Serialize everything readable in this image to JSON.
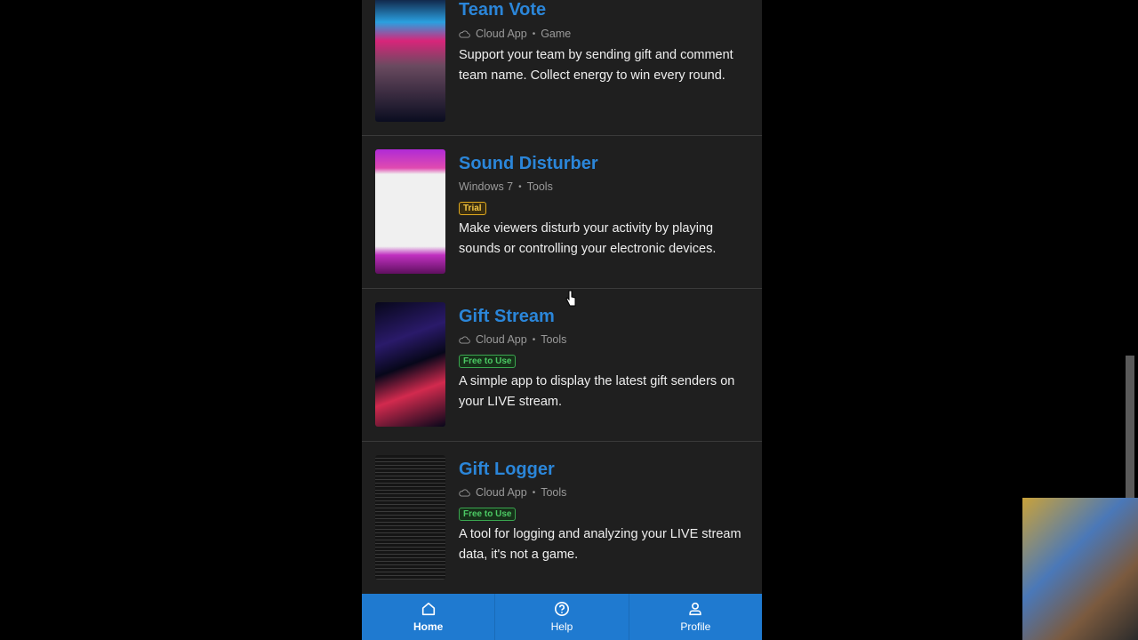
{
  "apps": [
    {
      "title": "Team Vote",
      "platform": "Cloud App",
      "category": "Game",
      "badge": null,
      "description": "Support your team by sending gift and comment team name. Collect energy to win every round.",
      "thumb_colors": [
        "#0e1a3a",
        "#d8257a"
      ]
    },
    {
      "title": "Sound Disturber",
      "platform": "Windows 7",
      "category": "Tools",
      "badge": "Trial",
      "description": "Make viewers disturb your activity by playing sounds or controlling your electronic devices.",
      "thumb_colors": [
        "#b02ad6",
        "#f0f0f0"
      ]
    },
    {
      "title": "Gift Stream",
      "platform": "Cloud App",
      "category": "Tools",
      "badge": "Free to Use",
      "description": "A simple app to display the latest gift senders on your LIVE stream.",
      "thumb_colors": [
        "#07071a",
        "#d22a4e"
      ]
    },
    {
      "title": "Gift Logger",
      "platform": "Cloud App",
      "category": "Tools",
      "badge": "Free to Use",
      "description": "A tool for logging and analyzing your LIVE stream data, it's not a game.",
      "thumb_colors": [
        "#111",
        "#444"
      ]
    }
  ],
  "nav": {
    "home": "Home",
    "help": "Help",
    "profile": "Profile"
  },
  "colors": {
    "accent": "#1f7ad0",
    "title": "#2b86d9",
    "trial": "#f4c542",
    "free": "#4cc964"
  }
}
